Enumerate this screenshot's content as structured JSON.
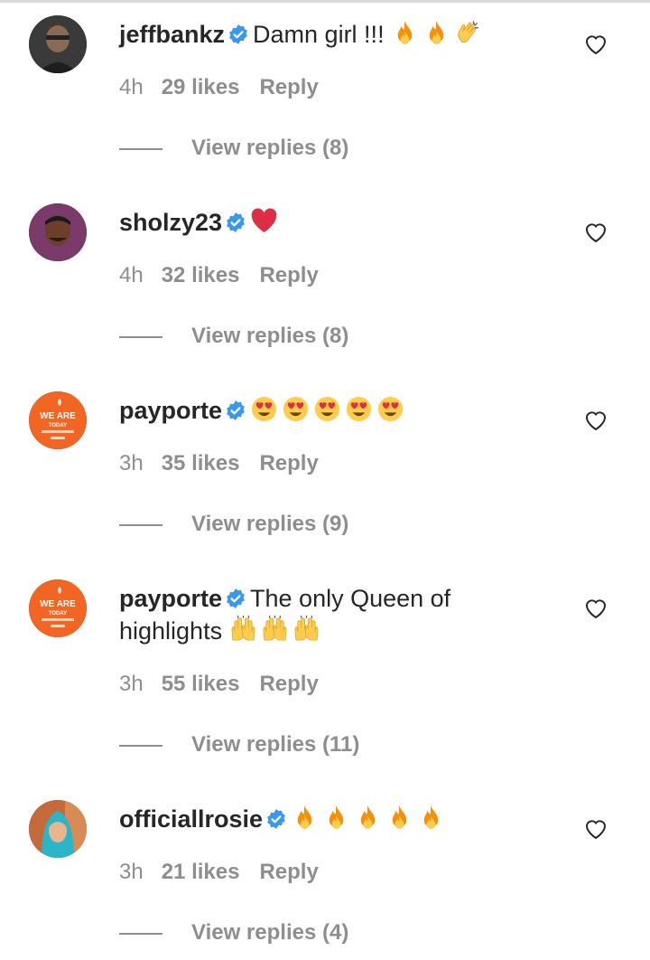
{
  "comments": [
    {
      "username": "jeffbankz",
      "text": "Damn girl !!! ",
      "emojis": [
        "fire",
        "fire",
        "clap"
      ],
      "time": "4h",
      "likes": "29 likes",
      "reply": "Reply",
      "view_replies": "View replies (8)",
      "avatar_color": "#3b3b3b"
    },
    {
      "username": "sholzy23",
      "text": "",
      "emojis": [
        "red-heart"
      ],
      "time": "4h",
      "likes": "32 likes",
      "reply": "Reply",
      "view_replies": "View replies (8)",
      "avatar_color": "#7a3a6a"
    },
    {
      "username": "payporte",
      "text": "",
      "emojis": [
        "heart-eyes",
        "heart-eyes",
        "heart-eyes",
        "heart-eyes",
        "heart-eyes"
      ],
      "time": "3h",
      "likes": "35 likes",
      "reply": "Reply",
      "view_replies": "View replies (9)",
      "avatar_color": "#f26522",
      "avatar_text": "WE ARE TODAY"
    },
    {
      "username": "payporte",
      "text": "The only Queen of highlights ",
      "emojis": [
        "raised-hands",
        "raised-hands",
        "raised-hands"
      ],
      "time": "3h",
      "likes": "55 likes",
      "reply": "Reply",
      "view_replies": "View replies (11)",
      "avatar_color": "#f26522",
      "avatar_text": "WE ARE TODAY"
    },
    {
      "username": "officiallrosie",
      "text": "",
      "emojis": [
        "fire",
        "fire",
        "fire",
        "fire",
        "fire"
      ],
      "time": "3h",
      "likes": "21 likes",
      "reply": "Reply",
      "view_replies": "View replies (4)",
      "avatar_color": "#2a8fa8"
    }
  ],
  "colors": {
    "verified": "#3897f0",
    "muted": "#8e8e8e",
    "text": "#262626"
  }
}
